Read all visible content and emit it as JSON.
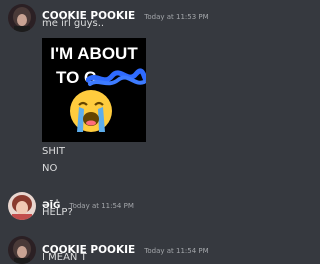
{
  "colors": {
    "background": "#36393f",
    "username": "#ffffff",
    "text": "#dcddde",
    "timestamp": "#a3a6aa"
  },
  "messages": [
    {
      "author": "COOKIE POOKIE",
      "timestamp": "Today at 11:53 PM",
      "lines": [
        "me irl guys.."
      ],
      "image": {
        "line1": "I'M ABOUT",
        "line2": "TO C",
        "emoji": "loudly-crying-face-icon"
      },
      "after_lines": [
        "SHIT",
        "NO"
      ]
    },
    {
      "author": "ƏĪĠ",
      "timestamp": "Today at 11:54 PM",
      "lines": [
        "HELP?"
      ]
    },
    {
      "author": "COOKIE POOKIE",
      "timestamp": "Today at 11:54 PM",
      "lines": [
        "I MEAN T"
      ]
    }
  ]
}
